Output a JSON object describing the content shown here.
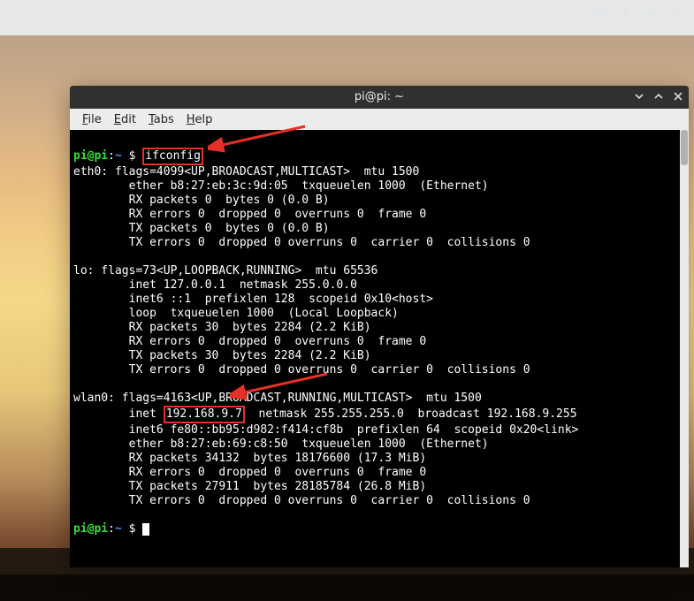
{
  "topbar": {
    "icons": [
      "box-icon",
      "bluetooth-icon",
      "network-icon",
      "volume-icon"
    ]
  },
  "window": {
    "title": "pi@pi: ~",
    "controls": {
      "min": "v",
      "max": "^",
      "close": "x"
    }
  },
  "menubar": {
    "file": {
      "accel": "F",
      "rest": "ile"
    },
    "edit": {
      "accel": "E",
      "rest": "dit"
    },
    "tabs": {
      "accel": "T",
      "rest": "abs"
    },
    "help": {
      "accel": "H",
      "rest": "elp"
    }
  },
  "prompt": {
    "user": "pi@pi",
    "sep1": ":",
    "tilde": "~",
    "sep2": " ",
    "dollar": "$"
  },
  "command": "ifconfig",
  "highlight_ip": "192.168.9.7",
  "lines": {
    "l01": "eth0: flags=4099<UP,BROADCAST,MULTICAST>  mtu 1500",
    "l02": "        ether b8:27:eb:3c:9d:05  txqueuelen 1000  (Ethernet)",
    "l03": "        RX packets 0  bytes 0 (0.0 B)",
    "l04": "        RX errors 0  dropped 0  overruns 0  frame 0",
    "l05": "        TX packets 0  bytes 0 (0.0 B)",
    "l06": "        TX errors 0  dropped 0 overruns 0  carrier 0  collisions 0",
    "blankA": "",
    "l07": "lo: flags=73<UP,LOOPBACK,RUNNING>  mtu 65536",
    "l08": "        inet 127.0.0.1  netmask 255.0.0.0",
    "l09": "        inet6 ::1  prefixlen 128  scopeid 0x10<host>",
    "l10": "        loop  txqueuelen 1000  (Local Loopback)",
    "l11": "        RX packets 30  bytes 2284 (2.2 KiB)",
    "l12": "        RX errors 0  dropped 0  overruns 0  frame 0",
    "l13": "        TX packets 30  bytes 2284 (2.2 KiB)",
    "l14": "        TX errors 0  dropped 0 overruns 0  carrier 0  collisions 0",
    "blankB": "",
    "l15": "wlan0: flags=4163<UP,BROADCAST,RUNNING,MULTICAST>  mtu 1500",
    "l16a": "        inet ",
    "l16b": "  netmask 255.255.255.0  broadcast 192.168.9.255",
    "l17": "        inet6 fe80::bb95:d982:f414:cf8b  prefixlen 64  scopeid 0x20<link>",
    "l18": "        ether b8:27:eb:69:c8:50  txqueuelen 1000  (Ethernet)",
    "l19": "        RX packets 34132  bytes 18176600 (17.3 MiB)",
    "l20": "        RX errors 0  dropped 0  overruns 0  frame 0",
    "l21": "        TX packets 27911  bytes 28185784 (26.8 MiB)",
    "l22": "        TX errors 0  dropped 0 overruns 0  carrier 0  collisions 0",
    "blankC": ""
  }
}
